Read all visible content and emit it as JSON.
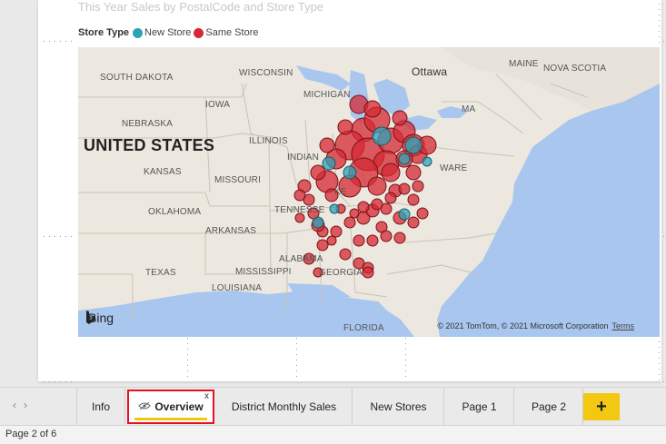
{
  "visual": {
    "title": "This Year Sales by PostalCode and Store Type",
    "legend_title": "Store Type",
    "legend_items": [
      {
        "label": "New Store",
        "color": "#2ea3b8"
      },
      {
        "label": "Same Store",
        "color": "#d62a33"
      }
    ]
  },
  "map": {
    "country_label": "UNITED STATES",
    "labels": {
      "south_dakota": "SOUTH DAKOTA",
      "wisconsin": "WISCONSIN",
      "michigan": "MICHIGAN",
      "ottawa": "Ottawa",
      "maine": "MAINE",
      "nova_scotia": "NOVA SCOTIA",
      "iowa": "IOWA",
      "nebraska": "NEBRASKA",
      "illinois": "ILLINOIS",
      "indiana": "INDIAN",
      "kansas": "KANSAS",
      "missouri": "MISSOURI",
      "kentucky": "KE",
      "oklahoma": "OKLAHOMA",
      "tennessee": "TENNESSE",
      "arkansas": "ARKANSAS",
      "alabama": "ALABAMA",
      "mississippi": "MISSISSIPPI",
      "texas": "TEXAS",
      "georgia": "GEORGIA",
      "louisiana": "LOUISIANA",
      "florida": "FLORIDA",
      "ma": "MA",
      "ware": "WARE"
    },
    "bing_label": "Bing",
    "copyright": "© 2021 TomTom, © 2021 Microsoft Corporation",
    "terms": "Terms",
    "bubbles_same": [
      [
        400,
        143,
        13
      ],
      [
        415,
        132,
        14
      ],
      [
        385,
        160,
        16
      ],
      [
        405,
        170,
        18
      ],
      [
        430,
        155,
        14
      ],
      [
        445,
        145,
        12
      ],
      [
        455,
        160,
        12
      ],
      [
        425,
        180,
        14
      ],
      [
        400,
        190,
        16
      ],
      [
        370,
        175,
        11
      ],
      [
        360,
        200,
        12
      ],
      [
        385,
        205,
        12
      ],
      [
        415,
        205,
        10
      ],
      [
        430,
        190,
        10
      ],
      [
        460,
        170,
        10
      ],
      [
        470,
        160,
        10
      ],
      [
        380,
        140,
        8
      ],
      [
        360,
        160,
        8
      ],
      [
        395,
        115,
        10
      ],
      [
        410,
        120,
        9
      ],
      [
        440,
        130,
        8
      ],
      [
        445,
        175,
        9
      ],
      [
        455,
        190,
        8
      ],
      [
        350,
        190,
        8
      ],
      [
        335,
        205,
        7
      ],
      [
        365,
        215,
        7
      ],
      [
        340,
        220,
        6
      ],
      [
        345,
        235,
        6
      ],
      [
        355,
        255,
        6
      ],
      [
        370,
        255,
        6
      ],
      [
        385,
        245,
        6
      ],
      [
        400,
        240,
        7
      ],
      [
        410,
        232,
        7
      ],
      [
        425,
        230,
        6
      ],
      [
        440,
        240,
        7
      ],
      [
        455,
        245,
        6
      ],
      [
        420,
        250,
        6
      ],
      [
        395,
        265,
        6
      ],
      [
        410,
        265,
        6
      ],
      [
        425,
        260,
        6
      ],
      [
        380,
        280,
        6
      ],
      [
        395,
        290,
        6
      ],
      [
        405,
        295,
        6
      ],
      [
        440,
        262,
        6
      ],
      [
        355,
        270,
        6
      ],
      [
        330,
        215,
        6
      ],
      [
        350,
        248,
        7
      ],
      [
        435,
        210,
        7
      ],
      [
        445,
        208,
        6
      ],
      [
        455,
        220,
        6
      ],
      [
        460,
        205,
        6
      ],
      [
        415,
        225,
        6
      ],
      [
        400,
        228,
        6
      ],
      [
        390,
        235,
        5
      ],
      [
        375,
        230,
        5
      ],
      [
        430,
        218,
        6
      ],
      [
        365,
        265,
        5
      ],
      [
        340,
        285,
        6
      ],
      [
        405,
        300,
        6
      ],
      [
        350,
        300,
        5
      ],
      [
        330,
        240,
        5
      ],
      [
        465,
        235,
        6
      ]
    ],
    "bubbles_new": [
      [
        420,
        150,
        10
      ],
      [
        455,
        160,
        9
      ],
      [
        362,
        180,
        7
      ],
      [
        385,
        190,
        7
      ],
      [
        445,
        175,
        6
      ],
      [
        350,
        245,
        6
      ],
      [
        368,
        230,
        5
      ],
      [
        445,
        236,
        6
      ],
      [
        470,
        178,
        5
      ]
    ]
  },
  "tabs": {
    "items": [
      {
        "label": "Info"
      },
      {
        "label": "Overview"
      },
      {
        "label": "District Monthly Sales"
      },
      {
        "label": "New Stores"
      },
      {
        "label": "Page 1"
      },
      {
        "label": "Page 2"
      }
    ],
    "active_close": "x",
    "hidden_icon": "eye-slash-icon",
    "add_label": "+"
  },
  "status": {
    "page_text": "Page 2 of 6"
  }
}
